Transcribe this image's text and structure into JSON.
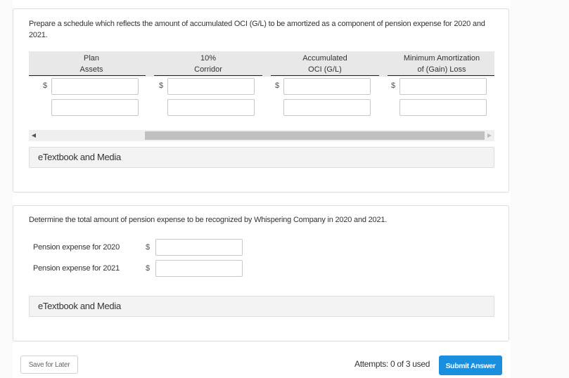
{
  "schedule_section": {
    "prompt": "Prepare a schedule which reflects the amount of accumulated OCI (G/L) to be amortized as a component of pension expense for 2020 and 2021.",
    "columns": [
      {
        "line1": "Plan",
        "line2": "Assets"
      },
      {
        "line1": "10%",
        "line2": "Corridor"
      },
      {
        "line1": "Accumulated",
        "line2": "OCI (G/L)"
      },
      {
        "line1": "Minimum Amortization",
        "line2": "of (Gain) Loss"
      }
    ],
    "currency_symbol": "$",
    "rows": [
      {
        "values": [
          "",
          "",
          "",
          ""
        ]
      },
      {
        "values": [
          "",
          "",
          "",
          ""
        ]
      }
    ],
    "scrollbar": {
      "left_arrow": "◀",
      "right_arrow": "▶"
    },
    "etextbook_label": "eTextbook and Media"
  },
  "expense_section": {
    "prompt": "Determine the total amount of pension expense to be recognized by Whispering Company in 2020 and 2021.",
    "currency_symbol": "$",
    "fields": [
      {
        "label": "Pension expense for 2020",
        "value": ""
      },
      {
        "label": "Pension expense for 2021",
        "value": ""
      }
    ],
    "etextbook_label": "eTextbook and Media"
  },
  "footer": {
    "save_label": "Save for Later",
    "attempts_text": "Attempts: 0 of 3 used",
    "submit_label": "Submit Answer"
  },
  "colors": {
    "submit_button": "#1a8fe0",
    "header_background": "#e8e8e8"
  }
}
